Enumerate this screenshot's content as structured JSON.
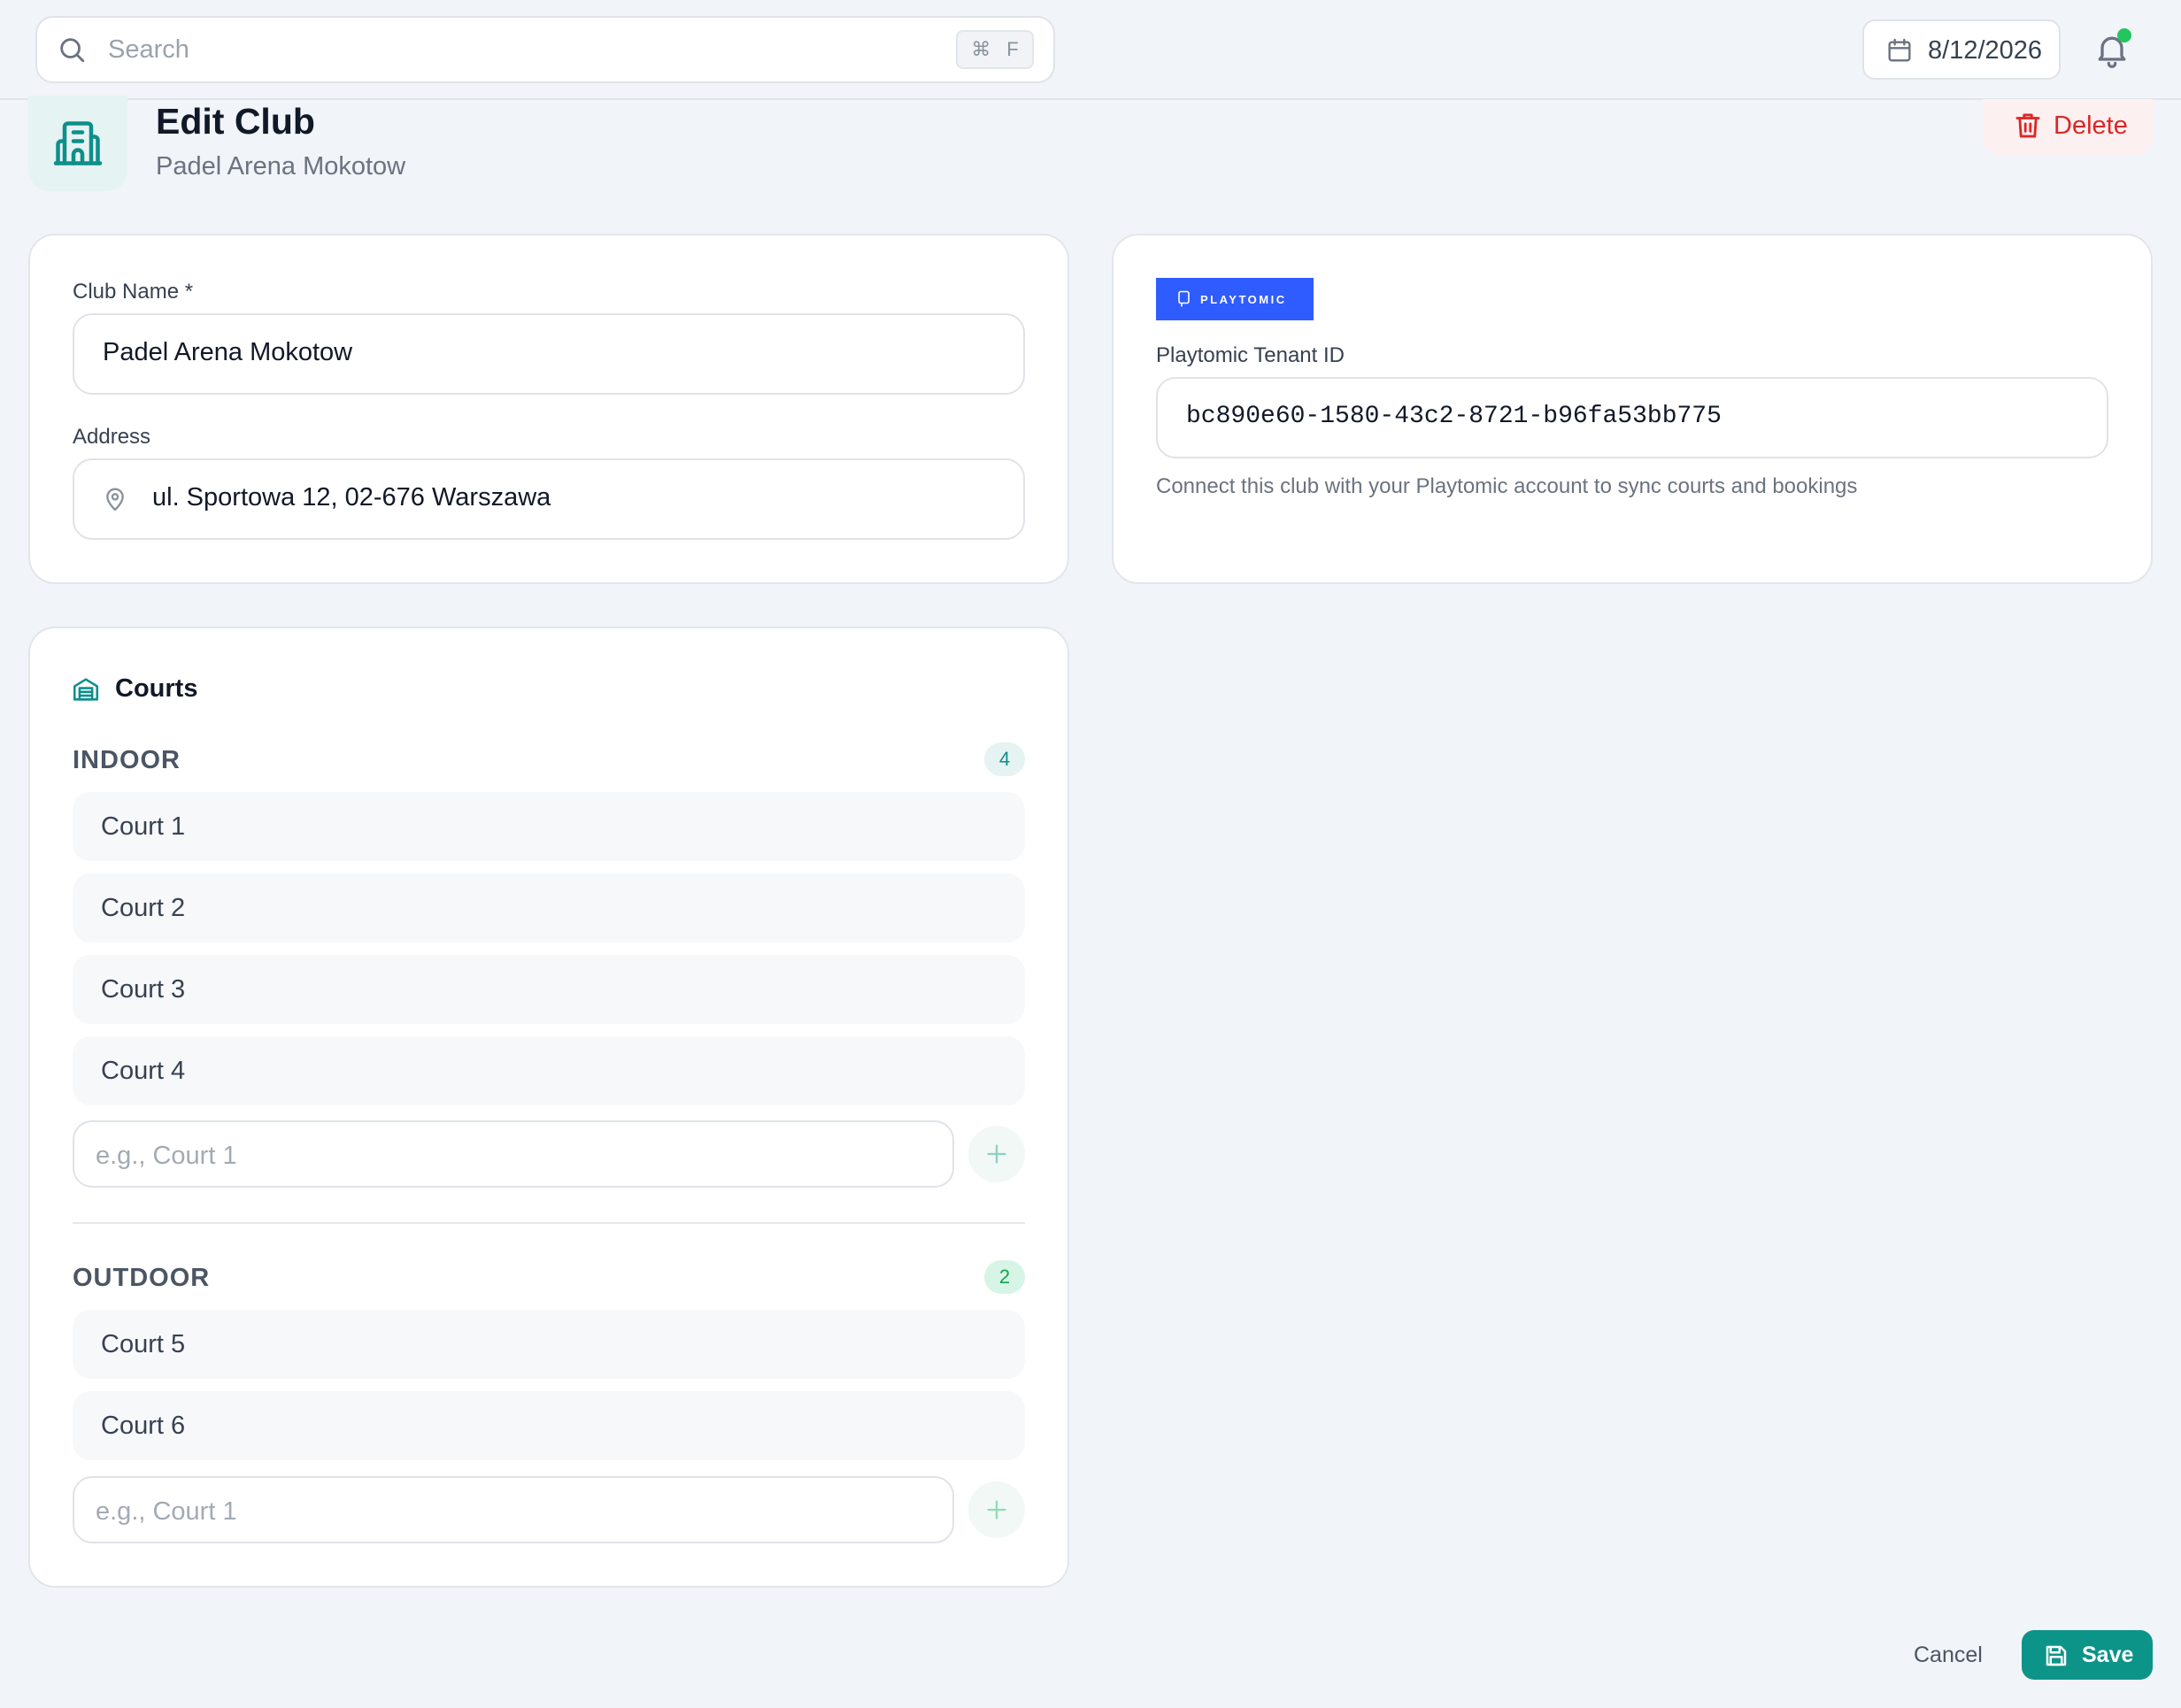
{
  "search": {
    "placeholder": "Search",
    "shortcut_key": "⌘",
    "shortcut_letter": "F"
  },
  "header": {
    "date": "8/12/2026"
  },
  "page": {
    "title": "Edit Club",
    "subtitle": "Padel Arena Mokotow",
    "delete_label": "Delete"
  },
  "form": {
    "club_name_label": "Club Name *",
    "club_name_value": "Padel Arena Mokotow",
    "address_label": "Address",
    "address_value": "ul. Sportowa 12, 02-676 Warszawa"
  },
  "playtomic": {
    "logo_text": "PLAYTOMIC",
    "tenant_label": "Playtomic Tenant ID",
    "tenant_value": "bc890e60-1580-43c2-8721-b96fa53bb775",
    "help": "Connect this club with your Playtomic account to sync courts and bookings"
  },
  "courts": {
    "title": "Courts",
    "indoor": {
      "label": "INDOOR",
      "count": "4",
      "items": [
        "Court 1",
        "Court 2",
        "Court 3",
        "Court 4"
      ],
      "placeholder": "e.g., Court 1"
    },
    "outdoor": {
      "label": "OUTDOOR",
      "count": "2",
      "items": [
        "Court 5",
        "Court 6"
      ],
      "placeholder": "e.g., Court 1"
    }
  },
  "footer": {
    "cancel_label": "Cancel",
    "save_label": "Save"
  },
  "colors": {
    "accent": "#0d9488",
    "danger": "#dc2626",
    "playtomic_blue": "#2f5cff",
    "status_dot": "#22c55e"
  }
}
